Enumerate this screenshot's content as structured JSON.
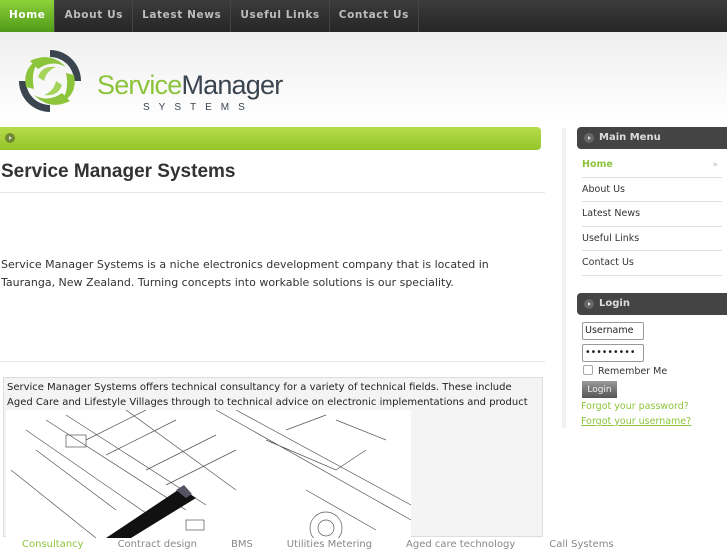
{
  "nav": {
    "items": [
      {
        "label": "Home"
      },
      {
        "label": "About Us"
      },
      {
        "label": "Latest News"
      },
      {
        "label": "Useful Links"
      },
      {
        "label": "Contact Us"
      }
    ]
  },
  "brand": {
    "name_green": "Service",
    "name_dark": "Manager",
    "tagline": "SYSTEMS"
  },
  "main": {
    "title": "Service Manager Systems",
    "intro": "Service Manager Systems is a niche electronics development company that is located in Tauranga, New Zealand. Turning concepts into workable solutions is our speciality.",
    "feature_text": "Service Manager Systems offers technical consultancy for a variety of technical fields. These include Aged Care and Lifestyle Villages through to technical advice on electronic implementations and product development.",
    "tabs": [
      {
        "label": "Consultancy"
      },
      {
        "label": "Contract design"
      },
      {
        "label": "BMS"
      },
      {
        "label": "Utilities Metering"
      },
      {
        "label": "Aged care technology"
      },
      {
        "label": "Call Systems"
      }
    ]
  },
  "sidebar": {
    "main_menu_title": "Main Menu",
    "menu": [
      {
        "label": "Home"
      },
      {
        "label": "About Us"
      },
      {
        "label": "Latest News"
      },
      {
        "label": "Useful Links"
      },
      {
        "label": "Contact Us"
      }
    ],
    "login_title": "Login",
    "username": "Username",
    "password": "•••••••••",
    "remember": "Remember Me",
    "login_button": "Login",
    "forgot_password": "Forgot your password?",
    "forgot_username": "Forgot your username?"
  }
}
